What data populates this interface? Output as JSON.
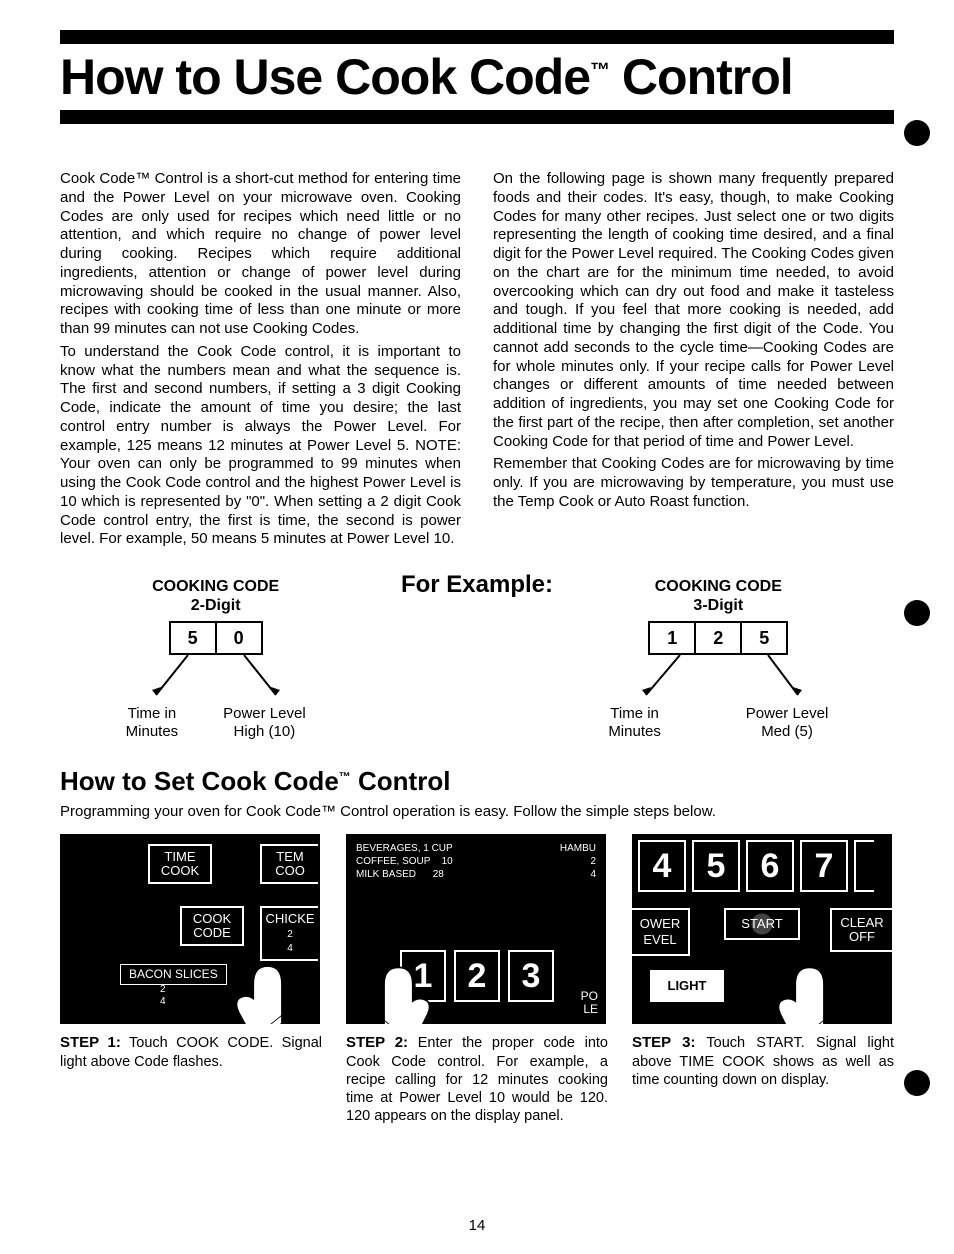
{
  "title_prefix": "How to Use Cook Code",
  "title_suffix": " Control",
  "tm": "™",
  "col1": {
    "p1": "Cook Code™ Control is a short-cut method for entering time and the Power Level on your microwave oven. Cooking Codes are only used for recipes which need little or no attention, and which require no change of power level during cooking. Recipes which require additional ingredients, attention or change of power level during microwaving should be cooked in the usual manner. Also, recipes with cooking time of less than one minute or more than 99 minutes can not use Cooking Codes.",
    "p2": "To understand the Cook Code control, it is important to know what the numbers mean and what the sequence is. The first and second numbers, if setting a 3 digit Cooking Code, indicate the amount of time you desire; the last control entry number is always the Power Level. For example, 125 means 12 minutes at Power Level 5. NOTE: Your oven can only be programmed to 99 minutes when using the Cook Code control and the highest Power Level is 10 which is represented by \"0\". When setting a 2 digit Cook Code control entry, the first is time, the second is power level. For example, 50 means 5 minutes at Power Level 10."
  },
  "col2": {
    "p1": "On the following page is shown many frequently prepared foods and their codes. It's easy, though, to make Cooking Codes for many other recipes. Just select one or two digits representing the length of cooking time desired, and a final digit for the Power Level required. The Cooking Codes given on the chart are for the minimum time needed, to avoid overcooking which can dry out food and make it tasteless and tough. If you feel that more cooking is needed, add additional time by changing the first digit of the Code. You cannot add seconds to the cycle time—Cooking Codes are for whole minutes only. If your recipe calls for Power Level changes or different amounts of time needed between addition of ingredients, you may set one Cooking Code for the first part of the recipe, then after completion, set another Cooking Code for that period of time and Power Level.",
    "p2": "Remember that Cooking Codes are for microwaving by time only. If you are microwaving by temperature, you must use the Temp Cook or Auto Roast function."
  },
  "example": {
    "title": "For Example:",
    "left": {
      "head1": "COOKING CODE",
      "head2": "2-Digit",
      "digits": [
        "5",
        "0"
      ],
      "label_left": "Time in\nMinutes",
      "label_right": "Power Level\nHigh (10)"
    },
    "right": {
      "head1": "COOKING CODE",
      "head2": "3-Digit",
      "digits": [
        "1",
        "2",
        "5"
      ],
      "label_left": "Time in\nMinutes",
      "label_right": "Power Level\nMed (5)"
    }
  },
  "sub_title_prefix": "How to Set Cook Code",
  "sub_title_suffix": " Control",
  "sub_instr": "Programming your oven for Cook Code™ Control operation is easy. Follow the simple steps below.",
  "panel1": {
    "btn_time": "TIME\nCOOK",
    "btn_temp": "TEM\nCOO",
    "btn_cook": "COOK\nCODE",
    "btn_chick": "CHICKE",
    "bacon": "BACON SLICES",
    "t2": "2",
    "t4": "4"
  },
  "panel2": {
    "h1": "BEVERAGES, 1 CUP",
    "h2a": "COFFEE, SOUP",
    "h2b": "10",
    "h3a": "MILK BASED",
    "h3b": "28",
    "hambu": "HAMBU",
    "h2c": "2",
    "h3c": "4",
    "d1": "1",
    "d2": "2",
    "d3": "3",
    "po1": "PO",
    "po2": "LE"
  },
  "panel3": {
    "d1": "4",
    "d2": "5",
    "d3": "6",
    "d4": "7",
    "btn_pl1": "OWER",
    "btn_pl2": "EVEL",
    "btn_start": "START",
    "btn_clear1": "CLEAR",
    "btn_clear2": "OFF",
    "btn_light": "LIGHT"
  },
  "step1": {
    "head": "STEP 1:",
    "body": " Touch COOK CODE. Signal light above Code flashes."
  },
  "step2": {
    "head": "STEP 2:",
    "body": " Enter the proper code into Cook Code control. For example, a recipe calling for 12 minutes cooking time at Power Level 10 would be 120. 120 appears on the display panel."
  },
  "step3": {
    "head": "STEP 3:",
    "body": " Touch START. Signal light above TIME COOK shows as well as time counting down on display."
  },
  "page_number": "14"
}
